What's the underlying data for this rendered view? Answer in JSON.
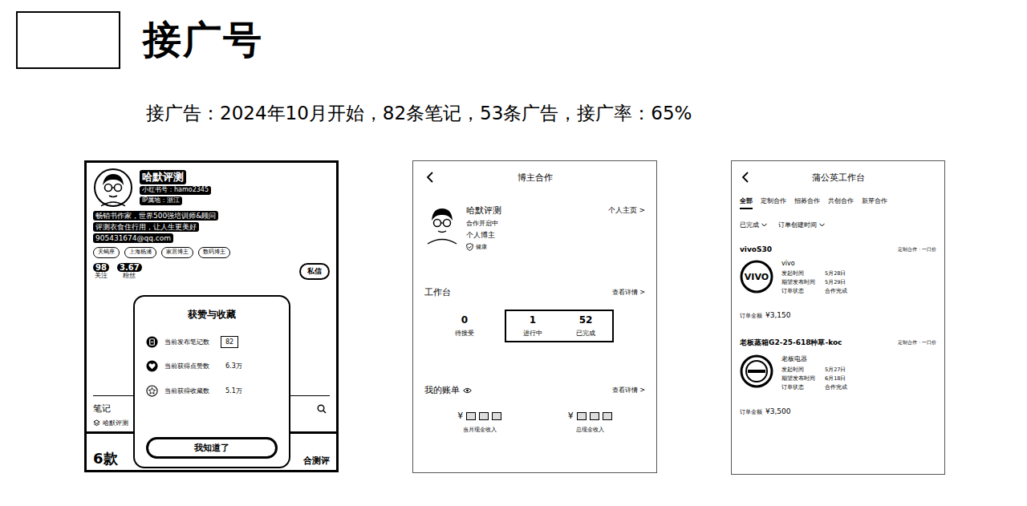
{
  "header": {
    "title": "接广号",
    "summary": "接广告：2024年10月开始，82条笔记，53条广告，接广率：65%"
  },
  "profile_screen": {
    "name": "哈默评测",
    "id_line": "小红书号：hamo2345",
    "ip_line": "IP属地：浙江",
    "bio": [
      "畅销书作家，世界500强培训师&顾问",
      "评测衣食住行用，让人生更美好",
      "905431674@qq.com"
    ],
    "tags": [
      "天蝎座",
      "上海杨浦",
      "家居博主",
      "数码博主"
    ],
    "stats": [
      {
        "value": "98",
        "label": "关注"
      },
      {
        "value": "3.67",
        "label": "粉丝"
      }
    ],
    "message_button": "私信",
    "tab": "笔记",
    "note_author": "哈默评测",
    "thumb_big": "6款",
    "thumb_side": "合测评",
    "popup": {
      "title": "获赞与收藏",
      "rows": [
        {
          "kind": "notes",
          "label": "当前发布笔记数",
          "value": "82",
          "highlighted": true
        },
        {
          "kind": "likes",
          "label": "当前获得点赞数",
          "value": "6.3万",
          "highlighted": false
        },
        {
          "kind": "collects",
          "label": "当前获得收藏数",
          "value": "5.1万",
          "highlighted": false
        }
      ],
      "button": "我知道了"
    }
  },
  "cooperation_screen": {
    "title": "博主合作",
    "name": "哈默评测",
    "homepage_link": "个人主页 >",
    "status": "合作开启中",
    "role": "个人博主",
    "health": "健康",
    "workbench": {
      "title": "工作台",
      "link": "查看详情 >",
      "stats": [
        {
          "value": "0",
          "label": "待接受",
          "highlighted": false
        },
        {
          "value": "1",
          "label": "进行中",
          "highlighted": true
        },
        {
          "value": "52",
          "label": "已完成",
          "highlighted": true
        }
      ]
    },
    "bill": {
      "title": "我的账单",
      "link": "查看详情 >",
      "items": [
        {
          "currency": "¥",
          "label": "当月现金收入"
        },
        {
          "currency": "¥",
          "label": "总现金收入"
        }
      ]
    }
  },
  "workbench_screen": {
    "title": "蒲公英工作台",
    "tabs": [
      {
        "label": "全部",
        "selected": true
      },
      {
        "label": "定制合作",
        "selected": false
      },
      {
        "label": "招募合作",
        "selected": false
      },
      {
        "label": "共创合作",
        "selected": false
      },
      {
        "label": "新芽合作",
        "selected": false
      }
    ],
    "filters": [
      "已完成",
      "订单创建时间"
    ],
    "orders": [
      {
        "title": "vivoS30",
        "type": "定制合作 · 一口价",
        "brand": "vivo",
        "logo_kind": "lettered",
        "logo_text": "VIVO",
        "fields": [
          {
            "label": "发起时间",
            "value": "5月28日"
          },
          {
            "label": "期望发布时间",
            "value": "5月29日"
          },
          {
            "label": "订单状态",
            "value": "合作完成"
          }
        ],
        "amount_label": "订单金额",
        "amount": "¥3,150"
      },
      {
        "title": "老板蒸箱G2-25-618种草-koc",
        "type": "定制合作 · 一口价",
        "brand": "老板电器",
        "logo_kind": "ring",
        "fields": [
          {
            "label": "发起时间",
            "value": "5月27日"
          },
          {
            "label": "期望发布时间",
            "value": "6月18日"
          },
          {
            "label": "订单状态",
            "value": "合作完成"
          }
        ],
        "amount_label": "订单金额",
        "amount": "¥3,500"
      }
    ]
  }
}
